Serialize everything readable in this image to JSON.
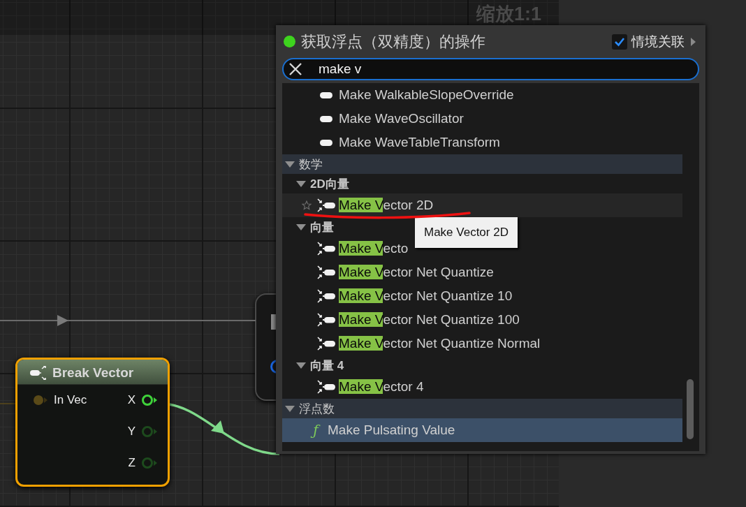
{
  "zoom_label": "缩放1:1",
  "node": {
    "title": "Break Vector",
    "selected": true,
    "inputs": [
      {
        "label": "In Vec",
        "connected": false
      }
    ],
    "outputs": [
      {
        "label": "X",
        "connected": true
      },
      {
        "label": "Y",
        "connected": false
      },
      {
        "label": "Z",
        "connected": false
      }
    ]
  },
  "menu": {
    "title": "获取浮点（双精度）的操作",
    "context_sensitive": {
      "label": "情境关联",
      "checked": true
    },
    "search": {
      "value": "make v"
    },
    "continued_items": [
      {
        "kind": "struct",
        "label": "Make WalkableSlopeOverride",
        "hovered": false,
        "selected": false
      },
      {
        "kind": "struct",
        "label": "Make WaveOscillator",
        "hovered": false,
        "selected": false
      },
      {
        "kind": "struct",
        "label": "Make WaveTableTransform",
        "hovered": false,
        "selected": false
      }
    ],
    "categories": [
      {
        "kind": "category",
        "label": "数学",
        "expanded": true,
        "children": [
          {
            "kind": "category",
            "label": "2D向量",
            "expanded": true,
            "children": [
              {
                "kind": "make",
                "match": "Make V",
                "label": "ector 2D",
                "hovered": true,
                "selected": false
              }
            ]
          },
          {
            "kind": "category",
            "label": "向量",
            "expanded": true,
            "children": [
              {
                "kind": "make",
                "match": "Make V",
                "label": "ecto",
                "hovered": false,
                "selected": false
              },
              {
                "kind": "make",
                "match": "Make V",
                "label": "ector Net Quantize",
                "hovered": false,
                "selected": false
              },
              {
                "kind": "make",
                "match": "Make V",
                "label": "ector Net Quantize 10",
                "hovered": false,
                "selected": false
              },
              {
                "kind": "make",
                "match": "Make V",
                "label": "ector Net Quantize 100",
                "hovered": false,
                "selected": false
              },
              {
                "kind": "make",
                "match": "Make V",
                "label": "ector Net Quantize Normal",
                "hovered": false,
                "selected": false
              }
            ]
          },
          {
            "kind": "category",
            "label": "向量 4",
            "expanded": true,
            "children": [
              {
                "kind": "make",
                "match": "Make V",
                "label": "ector 4",
                "hovered": false,
                "selected": false
              }
            ]
          }
        ]
      },
      {
        "kind": "category",
        "label": "浮点数",
        "expanded": true,
        "children": [
          {
            "kind": "function",
            "glyph": "ƒ",
            "label": "Make Pulsating Value",
            "hovered": false,
            "selected": true
          }
        ]
      }
    ],
    "tooltip": "Make Vector 2D"
  }
}
